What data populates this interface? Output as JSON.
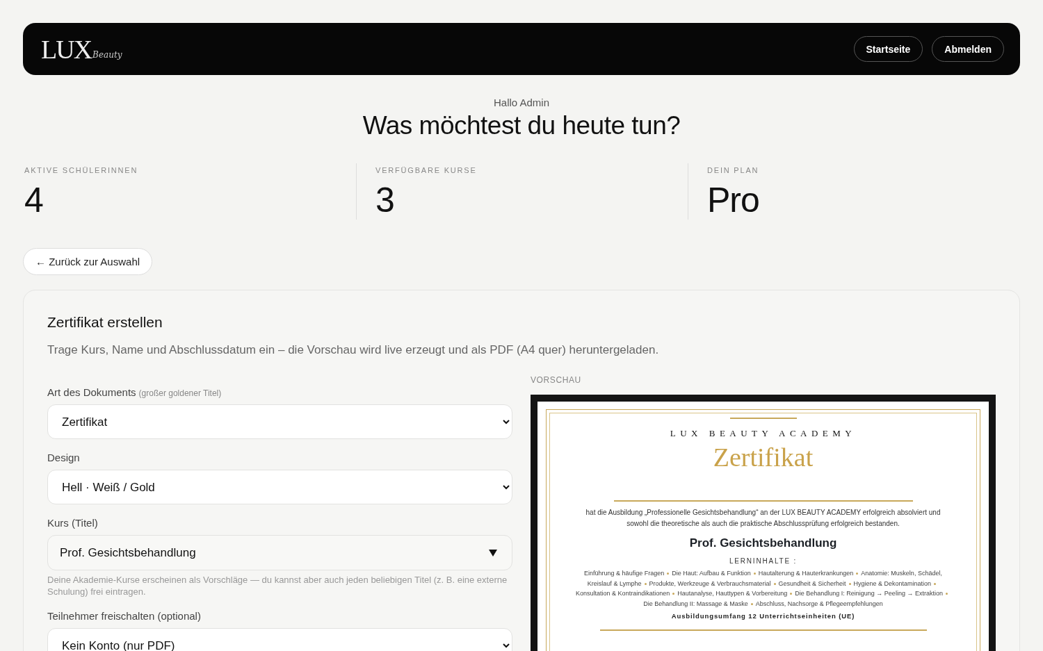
{
  "header": {
    "logo": {
      "main": "LUX",
      "script": "Beauty"
    },
    "nav": [
      "Startseite",
      "Abmelden"
    ]
  },
  "greeting": "Hallo Admin",
  "headline": "Was möchtest du heute tun?",
  "stats": [
    {
      "label": "AKTIVE SCHÜLERINNEN",
      "value": "4"
    },
    {
      "label": "VERFÜGBARE KURSE",
      "value": "3"
    },
    {
      "label": "DEIN PLAN",
      "value": "Pro"
    }
  ],
  "back_button": "← Zurück zur Auswahl",
  "card": {
    "title": "Zertifikat erstellen",
    "description": "Trage Kurs, Name und Abschlussdatum ein – die Vorschau wird live erzeugt und als PDF (A4 quer) heruntergeladen.",
    "fields": [
      {
        "kind": "select",
        "label": "Art des Dokuments",
        "hint": "(großer goldener Titel)",
        "value": "Zertifikat"
      },
      {
        "kind": "select",
        "label": "Design",
        "value": "Hell · Weiß / Gold"
      },
      {
        "kind": "combo",
        "label": "Kurs (Titel)",
        "value": "Prof. Gesichtsbehandlung",
        "help": "Deine Akademie-Kurse erscheinen als Vorschläge — du kannst aber auch jeden beliebigen Titel (z. B. eine externe Schulung) frei eintragen."
      },
      {
        "kind": "select",
        "label": "Teilnehmer freischalten (optional)",
        "value": "Kein Konto (nur PDF)"
      }
    ],
    "preview": {
      "label": "VORSCHAU",
      "academy": "LUX BEAUTY ACADEMY",
      "doc_title": "Zertifikat",
      "statement": "hat die Ausbildung „Professionelle Gesichtsbehandlung“ an der LUX BEAUTY ACADEMY erfolgreich absolviert und sowohl die theoretische als auch die praktische Abschlussprüfung erfolgreich bestanden.",
      "course": "Prof. Gesichtsbehandlung",
      "topics_heading": "LERNINHALTE :",
      "topics": [
        "Einführung & häufige Fragen",
        "Die Haut: Aufbau & Funktion",
        "Hautalterung & Hauterkrankungen",
        "Anatomie: Muskeln, Schädel, Kreislauf & Lymphe",
        "Produkte, Werkzeuge & Verbrauchsmaterial",
        "Gesundheit & Sicherheit",
        "Hygiene & Dekontamination",
        "Konsultation & Kontraindikationen",
        "Hautanalyse, Hauttypen & Vorbereitung",
        "Die Behandlung I: Reinigung → Peeling → Extraktion",
        "Die Behandlung II: Massage & Maske",
        "Abschluss, Nachsorge & Pflegeempfehlungen"
      ],
      "scope": "Ausbildungsumfang 12 Unterrichtseinheiten (UE)"
    }
  }
}
